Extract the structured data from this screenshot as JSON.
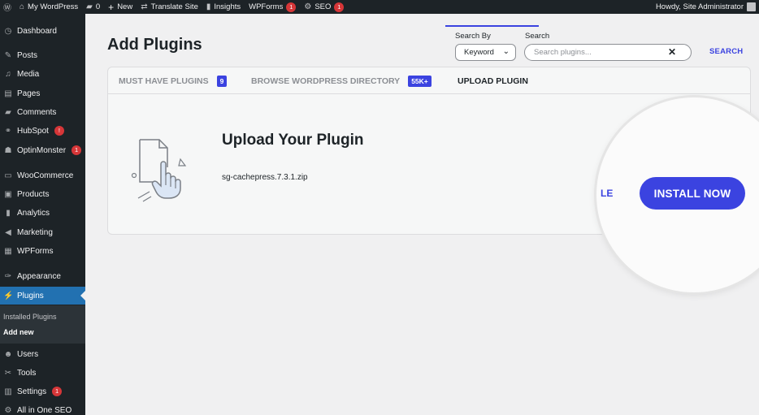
{
  "adminbar": {
    "site": "My WordPress",
    "comments": "0",
    "new": "New",
    "translate": "Translate Site",
    "insights": "Insights",
    "wpforms": "WPForms",
    "wpforms_badge": "1",
    "seo": "SEO",
    "seo_badge": "1",
    "howdy": "Howdy, Site Administrator"
  },
  "sidebar": {
    "items": [
      {
        "label": "Dashboard",
        "icon": "dashboard-icon"
      },
      {
        "label": "Posts",
        "icon": "pin-icon"
      },
      {
        "label": "Media",
        "icon": "media-icon"
      },
      {
        "label": "Pages",
        "icon": "pages-icon"
      },
      {
        "label": "Comments",
        "icon": "comments-icon"
      },
      {
        "label": "HubSpot",
        "icon": "hubspot-icon",
        "badge": "!"
      },
      {
        "label": "OptinMonster",
        "icon": "optinmonster-icon",
        "badge": "1"
      },
      {
        "label": "WooCommerce",
        "icon": "woocommerce-icon"
      },
      {
        "label": "Products",
        "icon": "products-icon"
      },
      {
        "label": "Analytics",
        "icon": "analytics-icon"
      },
      {
        "label": "Marketing",
        "icon": "marketing-icon"
      },
      {
        "label": "WPForms",
        "icon": "wpforms-icon"
      },
      {
        "label": "Appearance",
        "icon": "brush-icon"
      },
      {
        "label": "Plugins",
        "icon": "plug-icon"
      },
      {
        "label": "Users",
        "icon": "users-icon"
      },
      {
        "label": "Tools",
        "icon": "wrench-icon"
      },
      {
        "label": "Settings",
        "icon": "settings-icon",
        "badge": "1"
      },
      {
        "label": "All in One SEO",
        "icon": "aioseo-icon"
      }
    ],
    "submenu": [
      "Installed Plugins",
      "Add new"
    ]
  },
  "main": {
    "title": "Add Plugins",
    "search_by_label": "Search By",
    "search_by_value": "Keyword",
    "search_label": "Search",
    "search_placeholder": "Search plugins...",
    "search_button": "SEARCH"
  },
  "tabs": [
    {
      "label": "MUST HAVE PLUGINS",
      "badge": "9"
    },
    {
      "label": "BROWSE WORDPRESS DIRECTORY",
      "badge": "55K+"
    },
    {
      "label": "UPLOAD PLUGIN"
    }
  ],
  "upload": {
    "title": "Upload Your Plugin",
    "filename": "sg-cachepress.7.3.1.zip",
    "partial_link": "LE",
    "install_button": "INSTALL NOW"
  },
  "colors": {
    "accent": "#3b43e0",
    "admin_dark": "#1d2327",
    "wp_blue": "#2271b1",
    "badge_red": "#d63638"
  }
}
